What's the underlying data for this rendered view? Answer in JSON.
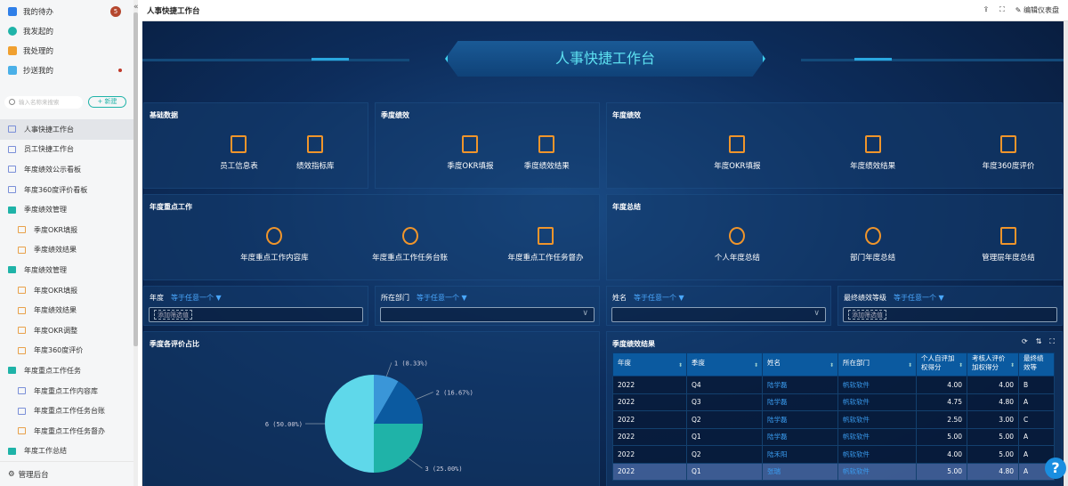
{
  "sidebar": {
    "todos": [
      {
        "label": "我的待办",
        "badge": "5",
        "color": "#2f7fe8"
      },
      {
        "label": "我发起的",
        "color": "#1fb3a8"
      },
      {
        "label": "我处理的",
        "color": "#f0a030"
      },
      {
        "label": "抄送我的",
        "color": "#4ab0e8"
      }
    ],
    "search_placeholder": "输入名称来搜索",
    "new_label": "+ 新建",
    "menu": [
      {
        "label": "人事快捷工作台",
        "type": "mon",
        "active": true
      },
      {
        "label": "员工快捷工作台",
        "type": "mon"
      },
      {
        "label": "年度绩效公示看板",
        "type": "mon"
      },
      {
        "label": "年度360度评价看板",
        "type": "mon"
      },
      {
        "label": "季度绩效管理",
        "type": "fold"
      },
      {
        "label": "季度OKR填报",
        "type": "org",
        "sub": true
      },
      {
        "label": "季度绩效结果",
        "type": "org",
        "sub": true
      },
      {
        "label": "年度绩效管理",
        "type": "fold"
      },
      {
        "label": "年度OKR填报",
        "type": "org",
        "sub": true
      },
      {
        "label": "年度绩效结果",
        "type": "org",
        "sub": true
      },
      {
        "label": "年度OKR调整",
        "type": "org",
        "sub": true
      },
      {
        "label": "年度360度评价",
        "type": "org",
        "sub": true
      },
      {
        "label": "年度重点工作任务",
        "type": "fold"
      },
      {
        "label": "年度重点工作内容库",
        "type": "mon",
        "sub": true
      },
      {
        "label": "年度重点工作任务台账",
        "type": "mon",
        "sub": true
      },
      {
        "label": "年度重点工作任务督办",
        "type": "org",
        "sub": true
      },
      {
        "label": "年度工作总结",
        "type": "fold"
      }
    ],
    "footer": "管理后台"
  },
  "topbar": {
    "title": "人事快捷工作台",
    "edit": "编辑仪表盘",
    "collapse": "«"
  },
  "dashboard": {
    "title": "人事快捷工作台",
    "panels": [
      {
        "title": "基础数据",
        "items": [
          "员工信息表",
          "绩效指标库"
        ]
      },
      {
        "title": "季度绩效",
        "items": [
          "季度OKR填报",
          "季度绩效结果"
        ]
      },
      {
        "title": "年度绩效",
        "items": [
          "年度OKR填报",
          "年度绩效结果",
          "年度360度评价"
        ]
      },
      {
        "title": "年度重点工作",
        "items": [
          "年度重点工作内容库",
          "年度重点工作任务台账",
          "年度重点工作任务督办"
        ]
      },
      {
        "title": "年度总结",
        "items": [
          "个人年度总结",
          "部门年度总结",
          "管理层年度总结"
        ]
      }
    ],
    "filters": [
      {
        "label": "年度",
        "op": "等于任意一个 ▼",
        "tag": "添加筛选值"
      },
      {
        "label": "所在部门",
        "op": "等于任意一个 ▼",
        "chev": "∨"
      },
      {
        "label": "姓名",
        "op": "等于任意一个 ▼",
        "chev": "∨"
      },
      {
        "label": "最终绩效等级",
        "op": "等于任意一个 ▼",
        "tag": "添加筛选值"
      }
    ],
    "pie_title": "季度各评价占比",
    "table_title": "季度绩效结果",
    "table": {
      "headers": [
        "年度",
        "季度",
        "姓名",
        "所在部门",
        "个人自评加权得分",
        "考核人评价加权得分",
        "最终绩效等"
      ],
      "rows": [
        [
          "2022",
          "Q4",
          "陆学磊",
          "帆软软件",
          "4.00",
          "4.00",
          "B"
        ],
        [
          "2022",
          "Q3",
          "陆学磊",
          "帆软软件",
          "4.75",
          "4.80",
          "A"
        ],
        [
          "2022",
          "Q2",
          "陆学磊",
          "帆软软件",
          "2.50",
          "3.00",
          "C"
        ],
        [
          "2022",
          "Q1",
          "陆学磊",
          "帆软软件",
          "5.00",
          "5.00",
          "A"
        ],
        [
          "2022",
          "Q2",
          "陆禾阳",
          "帆软软件",
          "4.00",
          "5.00",
          "A"
        ],
        [
          "2022",
          "Q1",
          "张瑞",
          "帆软软件",
          "5.00",
          "4.80",
          "A"
        ]
      ]
    },
    "help": "?"
  },
  "chart_data": {
    "type": "pie",
    "title": "季度各评价占比",
    "slices": [
      {
        "label": "1 (8.33%)",
        "value": 1,
        "color": "#3a96d8"
      },
      {
        "label": "2 (16.67%)",
        "value": 2,
        "color": "#0b5aa0"
      },
      {
        "label": "3 (25.00%)",
        "value": 3,
        "color": "#1fb3a8"
      },
      {
        "label": "6 (50.00%)",
        "value": 6,
        "color": "#5fd8ea"
      }
    ]
  }
}
